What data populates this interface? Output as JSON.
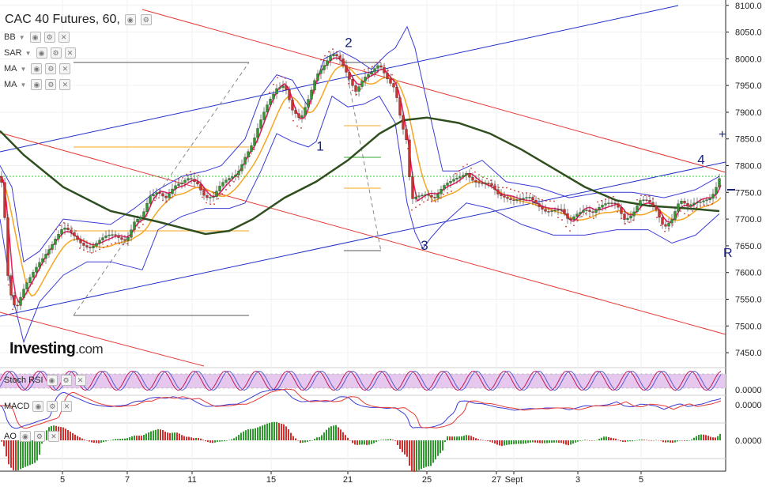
{
  "header": {
    "title": "CAC 40 Futures, 60,",
    "indicators": [
      "BB",
      "SAR",
      "MA",
      "MA"
    ]
  },
  "logo": {
    "main": "Investing",
    "suffix": ".com"
  },
  "colors": {
    "candle_up": "#2e9a2e",
    "candle_down": "#d32f2f",
    "bollinger": "#3b3bd6",
    "sar": "#d32f2f",
    "ma_fast": "#e91e63",
    "ma_mid": "#f5a623",
    "ma_slow": "#2f4f1f",
    "trend_blue": "#1f2fc8",
    "trend_red": "#e53935",
    "green_level": "#33cc33",
    "rsi_fill": "#e6c8ee",
    "rsi_line1": "#c2185b",
    "rsi_line2": "#5b5bd6",
    "macd_line": "#3b3bd6",
    "macd_signal": "#e53935"
  },
  "chart_data": {
    "type": "candlestick",
    "title": "CAC 40 Futures, 60,",
    "y_axis": {
      "range": [
        7425,
        8110
      ],
      "ticks": [
        "8100.0",
        "8050.0",
        "8000.0",
        "7950.0",
        "7900.0",
        "7850.0",
        "7800.0",
        "7750.0",
        "7700.0",
        "7650.0",
        "7600.0",
        "7550.0",
        "7500.0",
        "7450.0"
      ]
    },
    "x_axis": {
      "labels": [
        "5",
        "7",
        "11",
        "15",
        "21",
        "25",
        "27",
        "Sept",
        "3",
        "5"
      ]
    },
    "current_price": 7780,
    "price_path": [
      [
        0,
        7780
      ],
      [
        4,
        7760
      ],
      [
        10,
        7600
      ],
      [
        16,
        7545
      ],
      [
        22,
        7540
      ],
      [
        30,
        7565
      ],
      [
        40,
        7590
      ],
      [
        50,
        7620
      ],
      [
        60,
        7645
      ],
      [
        70,
        7665
      ],
      [
        80,
        7680
      ],
      [
        90,
        7670
      ],
      [
        100,
        7660
      ],
      [
        115,
        7650
      ],
      [
        130,
        7660
      ],
      [
        145,
        7670
      ],
      [
        160,
        7665
      ],
      [
        170,
        7695
      ],
      [
        180,
        7700
      ],
      [
        190,
        7740
      ],
      [
        200,
        7755
      ],
      [
        210,
        7745
      ],
      [
        220,
        7760
      ],
      [
        230,
        7762
      ],
      [
        240,
        7775
      ],
      [
        250,
        7770
      ],
      [
        260,
        7745
      ],
      [
        270,
        7740
      ],
      [
        280,
        7760
      ],
      [
        290,
        7775
      ],
      [
        300,
        7790
      ],
      [
        310,
        7820
      ],
      [
        320,
        7840
      ],
      [
        330,
        7880
      ],
      [
        340,
        7920
      ],
      [
        350,
        7950
      ],
      [
        360,
        7955
      ],
      [
        370,
        7900
      ],
      [
        380,
        7880
      ],
      [
        390,
        7925
      ],
      [
        400,
        7975
      ],
      [
        410,
        7990
      ],
      [
        420,
        8005
      ],
      [
        430,
        7995
      ],
      [
        440,
        7970
      ],
      [
        450,
        7945
      ],
      [
        460,
        7965
      ],
      [
        470,
        7970
      ],
      [
        480,
        7985
      ],
      [
        490,
        7965
      ],
      [
        500,
        7950
      ],
      [
        508,
        7880
      ],
      [
        515,
        7840
      ],
      [
        520,
        7730
      ],
      [
        530,
        7740
      ],
      [
        540,
        7750
      ],
      [
        550,
        7745
      ],
      [
        560,
        7760
      ],
      [
        570,
        7765
      ],
      [
        580,
        7775
      ],
      [
        590,
        7790
      ],
      [
        600,
        7775
      ],
      [
        610,
        7765
      ],
      [
        620,
        7760
      ],
      [
        630,
        7745
      ],
      [
        640,
        7745
      ],
      [
        650,
        7740
      ],
      [
        660,
        7735
      ],
      [
        670,
        7735
      ],
      [
        680,
        7725
      ],
      [
        690,
        7720
      ],
      [
        700,
        7720
      ],
      [
        710,
        7715
      ],
      [
        720,
        7690
      ],
      [
        730,
        7710
      ],
      [
        740,
        7725
      ],
      [
        750,
        7715
      ],
      [
        760,
        7720
      ],
      [
        770,
        7725
      ],
      [
        780,
        7730
      ],
      [
        790,
        7705
      ],
      [
        800,
        7710
      ],
      [
        810,
        7730
      ],
      [
        820,
        7730
      ],
      [
        830,
        7720
      ],
      [
        840,
        7690
      ],
      [
        850,
        7700
      ],
      [
        860,
        7730
      ],
      [
        870,
        7720
      ],
      [
        880,
        7735
      ],
      [
        890,
        7740
      ],
      [
        900,
        7740
      ],
      [
        908,
        7760
      ],
      [
        912,
        7780
      ]
    ],
    "ma_slow": [
      [
        0,
        7865
      ],
      [
        30,
        7820
      ],
      [
        80,
        7760
      ],
      [
        140,
        7715
      ],
      [
        200,
        7695
      ],
      [
        260,
        7672
      ],
      [
        290,
        7678
      ],
      [
        320,
        7700
      ],
      [
        360,
        7740
      ],
      [
        400,
        7770
      ],
      [
        440,
        7810
      ],
      [
        480,
        7860
      ],
      [
        510,
        7885
      ],
      [
        540,
        7890
      ],
      [
        580,
        7880
      ],
      [
        620,
        7860
      ],
      [
        660,
        7830
      ],
      [
        700,
        7795
      ],
      [
        740,
        7760
      ],
      [
        780,
        7735
      ],
      [
        820,
        7725
      ],
      [
        870,
        7720
      ],
      [
        910,
        7715
      ]
    ],
    "bb_upper": [
      [
        0,
        7800
      ],
      [
        15,
        7760
      ],
      [
        30,
        7620
      ],
      [
        50,
        7640
      ],
      [
        80,
        7700
      ],
      [
        110,
        7695
      ],
      [
        140,
        7690
      ],
      [
        170,
        7720
      ],
      [
        200,
        7755
      ],
      [
        230,
        7780
      ],
      [
        260,
        7790
      ],
      [
        280,
        7800
      ],
      [
        310,
        7850
      ],
      [
        330,
        7930
      ],
      [
        350,
        7970
      ],
      [
        370,
        7960
      ],
      [
        390,
        7910
      ],
      [
        410,
        8000
      ],
      [
        430,
        8015
      ],
      [
        450,
        8000
      ],
      [
        470,
        7980
      ],
      [
        490,
        8010
      ],
      [
        500,
        8020
      ],
      [
        515,
        8060
      ],
      [
        525,
        8020
      ],
      [
        540,
        7920
      ],
      [
        560,
        7790
      ],
      [
        580,
        7790
      ],
      [
        610,
        7810
      ],
      [
        640,
        7770
      ],
      [
        680,
        7760
      ],
      [
        720,
        7740
      ],
      [
        760,
        7750
      ],
      [
        800,
        7750
      ],
      [
        840,
        7740
      ],
      [
        880,
        7755
      ],
      [
        910,
        7780
      ]
    ],
    "bb_lower": [
      [
        0,
        7700
      ],
      [
        15,
        7560
      ],
      [
        30,
        7470
      ],
      [
        50,
        7545
      ],
      [
        80,
        7595
      ],
      [
        110,
        7620
      ],
      [
        140,
        7620
      ],
      [
        180,
        7605
      ],
      [
        200,
        7680
      ],
      [
        230,
        7705
      ],
      [
        260,
        7720
      ],
      [
        290,
        7720
      ],
      [
        310,
        7730
      ],
      [
        330,
        7790
      ],
      [
        350,
        7860
      ],
      [
        370,
        7845
      ],
      [
        390,
        7835
      ],
      [
        400,
        7845
      ],
      [
        420,
        7930
      ],
      [
        440,
        7910
      ],
      [
        460,
        7915
      ],
      [
        480,
        7930
      ],
      [
        500,
        7880
      ],
      [
        515,
        7730
      ],
      [
        525,
        7675
      ],
      [
        535,
        7645
      ],
      [
        545,
        7665
      ],
      [
        560,
        7690
      ],
      [
        590,
        7730
      ],
      [
        620,
        7720
      ],
      [
        660,
        7690
      ],
      [
        700,
        7670
      ],
      [
        740,
        7670
      ],
      [
        780,
        7680
      ],
      [
        820,
        7680
      ],
      [
        850,
        7655
      ],
      [
        880,
        7670
      ],
      [
        910,
        7710
      ]
    ],
    "wave_labels": [
      {
        "label": "1",
        "value": 7837
      },
      {
        "label": "2",
        "value": 8031
      },
      {
        "label": "3",
        "value": 7651
      },
      {
        "label": "4",
        "value": 7812
      }
    ],
    "subcharts": [
      {
        "name": "Stoch RSI",
        "value_label": "0.0000"
      },
      {
        "name": "MACD",
        "value_label": "0.0000"
      },
      {
        "name": "AO",
        "value_label": "0.0000"
      }
    ]
  }
}
